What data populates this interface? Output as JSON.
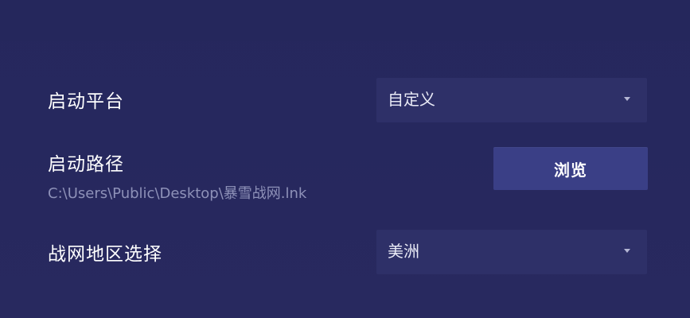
{
  "settings": {
    "platform": {
      "label": "启动平台",
      "value": "自定义"
    },
    "launch_path": {
      "label": "启动路径",
      "value": "C:\\Users\\Public\\Desktop\\暴雪战网.lnk",
      "browse_label": "浏览"
    },
    "region": {
      "label": "战网地区选择",
      "value": "美洲"
    }
  },
  "icons": {
    "dropdown": "chevron-down-icon"
  },
  "colors": {
    "background": "#27295f",
    "select_background": "#2e3068",
    "button_background": "#3a3f86",
    "path_text": "#8e91b8"
  }
}
